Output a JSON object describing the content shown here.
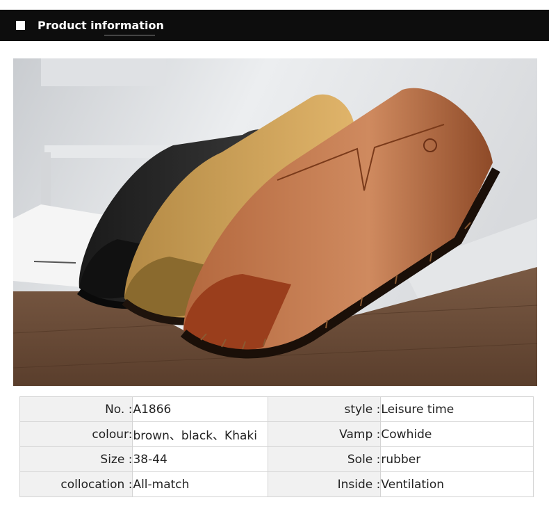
{
  "header": {
    "title": "Product information"
  },
  "photo": {
    "subject": "three slip-on leather loafers (black, khaki, brown) on a wooden floor"
  },
  "specs": [
    {
      "left_label": "No. :",
      "left_value": "A1866",
      "right_label": "style :",
      "right_value": "Leisure time"
    },
    {
      "left_label": "colour:",
      "left_value": "brown、black、Khaki",
      "right_label": "Vamp :",
      "right_value": "Cowhide"
    },
    {
      "left_label": "Size :",
      "left_value": "38-44",
      "right_label": "Sole :",
      "right_value": "rubber"
    },
    {
      "left_label": "collocation :",
      "left_value": "All-match",
      "right_label": "Inside :",
      "right_value": "Ventilation"
    }
  ],
  "colors": {
    "header_bg": "#0d0d0d",
    "label_bg": "#f1f1f1",
    "border": "#d4d4d4"
  }
}
